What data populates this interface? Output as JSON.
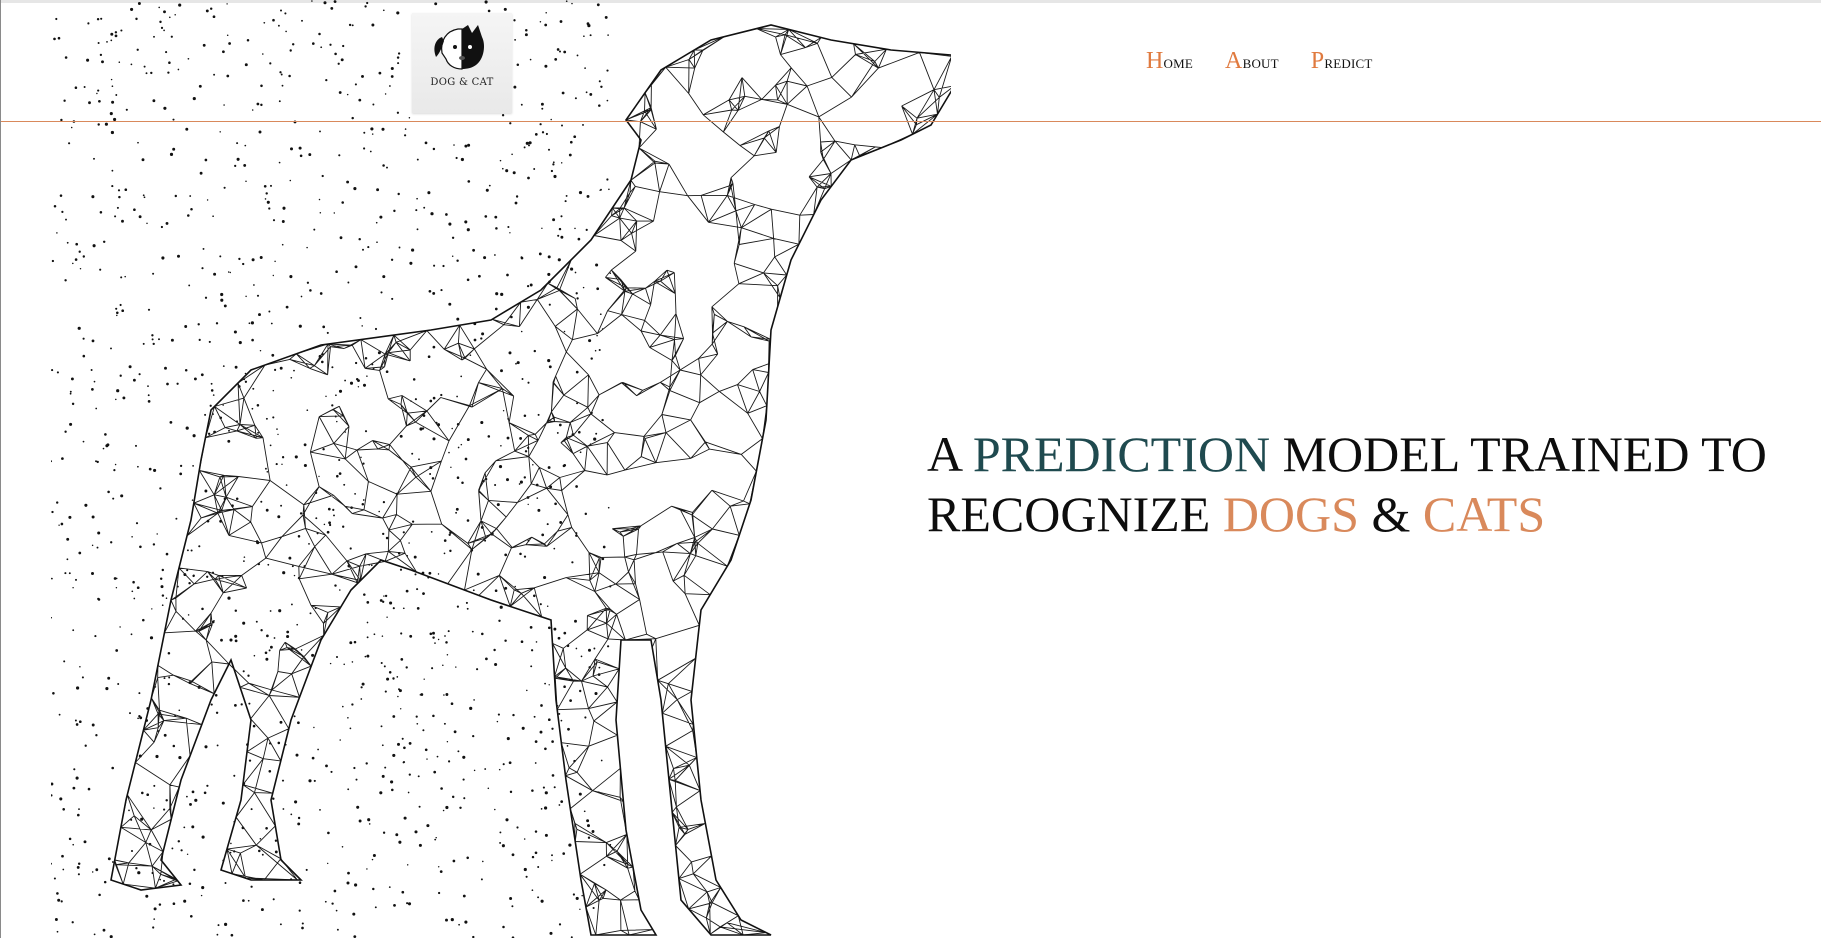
{
  "logo": {
    "text": "DOG & CAT"
  },
  "nav": {
    "items": [
      {
        "first": "H",
        "rest": "ome"
      },
      {
        "first": "A",
        "rest": "bout"
      },
      {
        "first": "P",
        "rest": "redict"
      }
    ]
  },
  "hero": {
    "line1_a": "A",
    "line1_b": "PREDICTION",
    "line1_c": "MODEL TRAINED TO",
    "line2_a": "RECOGNIZE",
    "line2_b": "DOGS",
    "line2_c": "&",
    "line2_d": "CATS"
  },
  "colors": {
    "accent_orange": "#d9895b",
    "accent_teal": "#1f4a4f",
    "text": "#0d0d0d"
  },
  "icons": {
    "logo": "dog-cat-icon",
    "hero_image": "wireframe-dog-illustration"
  }
}
